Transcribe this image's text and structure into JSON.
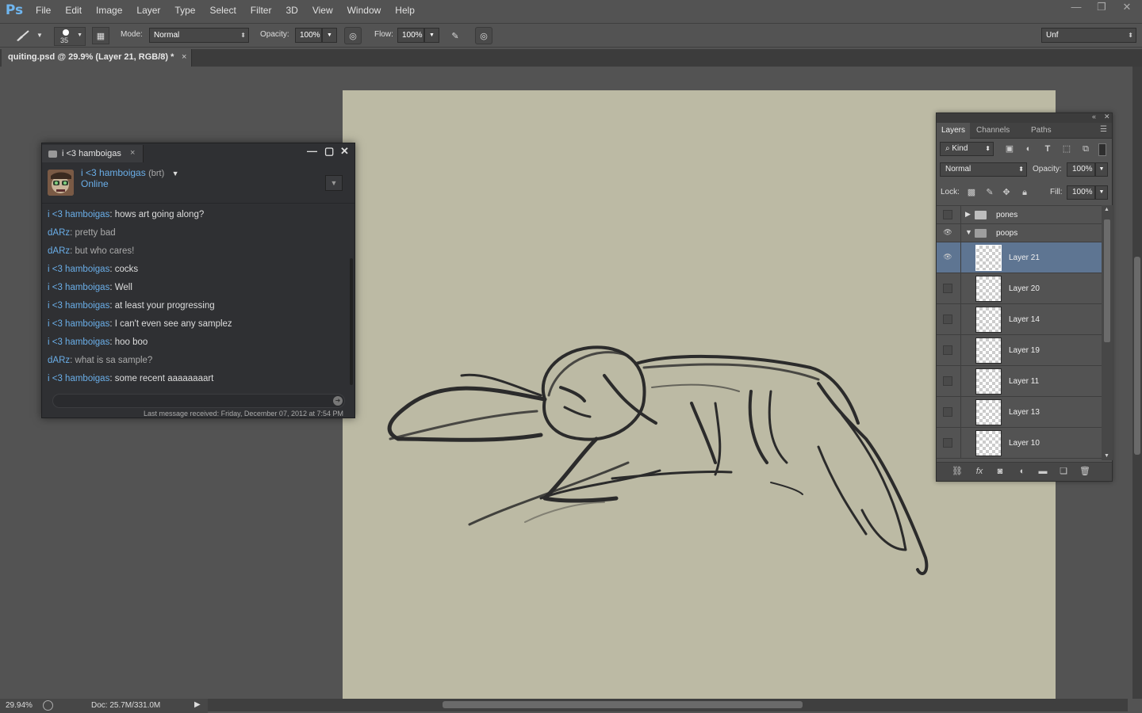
{
  "app": {
    "logo": "Ps",
    "menu": [
      "File",
      "Edit",
      "Image",
      "Layer",
      "Type",
      "Select",
      "Filter",
      "3D",
      "View",
      "Window",
      "Help"
    ],
    "window_controls": [
      "minimize-icon",
      "restore-icon",
      "close-icon"
    ]
  },
  "options_bar": {
    "brush_size": "35",
    "mode_label": "Mode:",
    "mode_value": "Normal",
    "opacity_label": "Opacity:",
    "opacity_value": "100%",
    "flow_label": "Flow:",
    "flow_value": "100%",
    "workspace_value": "Unf"
  },
  "document": {
    "tab_title": "quiting.psd @ 29.9% (Layer 21, RGB/8) *",
    "close": "×",
    "canvas_color": "#bcbaa4"
  },
  "status": {
    "zoom": "29.94%",
    "doc_size": "Doc: 25.7M/331.0M"
  },
  "chat": {
    "tab_title": "i <3 hamboigas",
    "tab_close": "×",
    "contact_name": "i <3 hamboigas",
    "contact_suffix": "(brt)",
    "contact_status": "Online",
    "messages": [
      {
        "sender": "i <3 hamboigas",
        "text": ": hows art going along?"
      },
      {
        "sender": "dARz",
        "text": ": pretty bad"
      },
      {
        "sender": "dARz",
        "text": ": but who cares!"
      },
      {
        "sender": "i <3 hamboigas",
        "text": ": cocks"
      },
      {
        "sender": "i <3 hamboigas",
        "text": ": Well"
      },
      {
        "sender": "i <3 hamboigas",
        "text": ": at least your progressing"
      },
      {
        "sender": "i <3 hamboigas",
        "text": ": I can't even see any samplez"
      },
      {
        "sender": "i <3 hamboigas",
        "text": ": hoo boo"
      },
      {
        "sender": "dARz",
        "text": ": what is sa sample?"
      },
      {
        "sender": "i <3 hamboigas",
        "text": ": some recent aaaaaaaart"
      }
    ],
    "footer": "Last message received: Friday, December 07, 2012 at 7:54 PM",
    "accent_color": "#6aaee8"
  },
  "layers_panel": {
    "tabs": [
      "Layers",
      "Channels",
      "Paths"
    ],
    "filter_value": "Kind",
    "blend_mode": "Normal",
    "opacity_label": "Opacity:",
    "opacity_value": "100%",
    "lock_label": "Lock:",
    "fill_label": "Fill:",
    "fill_value": "100%",
    "groups": [
      {
        "name": "pones",
        "expanded": false,
        "visible": false
      },
      {
        "name": "poops",
        "expanded": true,
        "visible": true
      }
    ],
    "layers": [
      {
        "name": "Layer 21",
        "visible": true,
        "selected": true
      },
      {
        "name": "Layer 20",
        "visible": false,
        "selected": false
      },
      {
        "name": "Layer 14",
        "visible": false,
        "selected": false
      },
      {
        "name": "Layer 19",
        "visible": false,
        "selected": false
      },
      {
        "name": "Layer 11",
        "visible": false,
        "selected": false
      },
      {
        "name": "Layer 13",
        "visible": false,
        "selected": false
      },
      {
        "name": "Layer 10",
        "visible": false,
        "selected": false
      }
    ],
    "selection_color": "#5e7592"
  }
}
